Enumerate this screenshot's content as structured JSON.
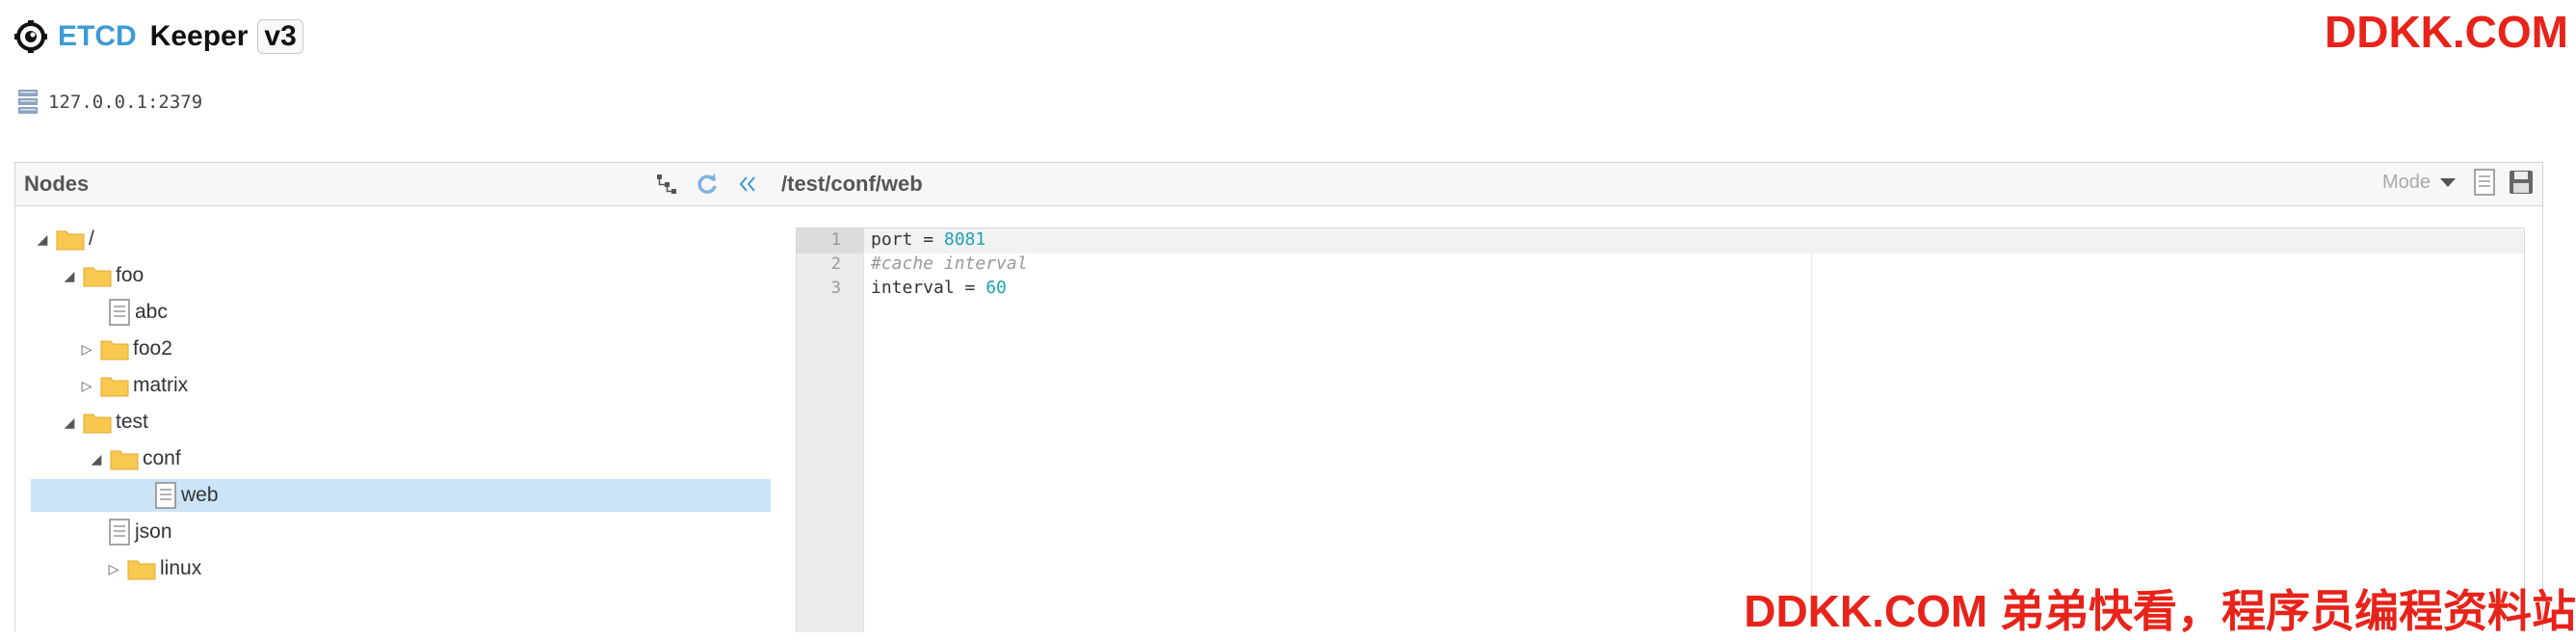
{
  "app": {
    "brand_etcd": "ETCD",
    "brand_keeper": "Keeper",
    "version": "v3",
    "server_address": "127.0.0.1:2379"
  },
  "watermark": {
    "top": "DDKK.COM",
    "bottom": "DDKK.COM 弟弟快看，程序员编程资料站"
  },
  "nodes_panel": {
    "title": "Nodes",
    "tools": [
      "tree-view-icon",
      "refresh-icon",
      "collapse-icon"
    ]
  },
  "tree": [
    {
      "label": "/",
      "type": "folder",
      "depth": 0,
      "toggle": "expanded"
    },
    {
      "label": "foo",
      "type": "folder",
      "depth": 1,
      "toggle": "expanded"
    },
    {
      "label": "abc",
      "type": "file",
      "depth": 2,
      "toggle": "none"
    },
    {
      "label": "foo2",
      "type": "folder",
      "depth": 1,
      "toggle": "collapsed"
    },
    {
      "label": "matrix",
      "type": "folder",
      "depth": 1,
      "toggle": "collapsed"
    },
    {
      "label": "test",
      "type": "folder",
      "depth": 1,
      "toggle": "expanded"
    },
    {
      "label": "conf",
      "type": "folder",
      "depth": 2,
      "toggle": "expanded"
    },
    {
      "label": "web",
      "type": "file",
      "depth": 3,
      "toggle": "none",
      "selected": true
    },
    {
      "label": "json",
      "type": "file",
      "depth": 2,
      "toggle": "none"
    },
    {
      "label": "linux",
      "type": "folder",
      "depth": 2,
      "toggle": "collapsed"
    }
  ],
  "editor": {
    "path": "/test/conf/web",
    "mode_label": "Mode",
    "lines": [
      {
        "num": "1",
        "key": "port",
        "op": " = ",
        "value": "8081",
        "comment": ""
      },
      {
        "num": "2",
        "key": "",
        "op": "",
        "value": "",
        "comment": "#cache interval"
      },
      {
        "num": "3",
        "key": "interval",
        "op": " = ",
        "value": "60",
        "comment": ""
      }
    ]
  },
  "colors": {
    "brand_blue": "#3c9bd8",
    "selected_row": "#cce4f7",
    "watermark_red": "#e8231a",
    "folder_yellow": "#f9c850",
    "number_teal": "#1aa3b5"
  }
}
